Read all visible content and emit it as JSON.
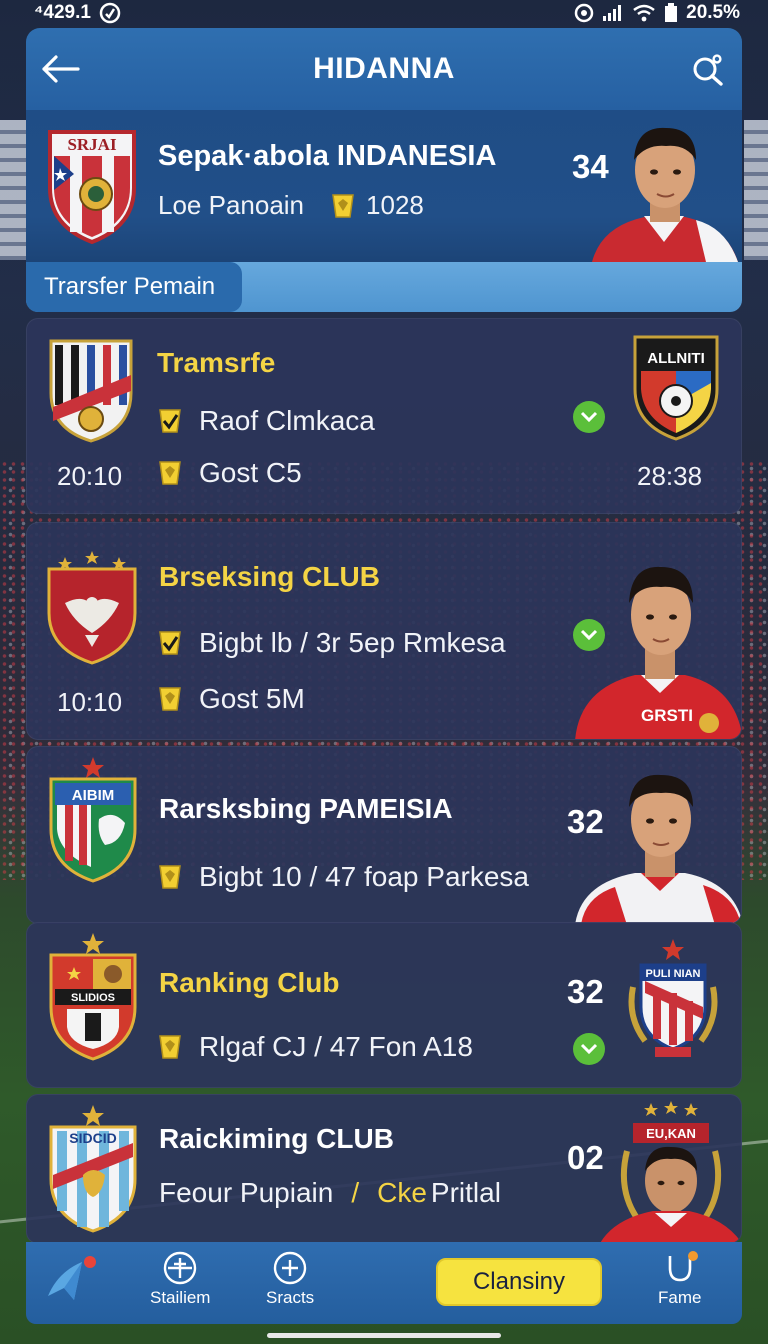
{
  "status_bar": {
    "left_text": "⁴429.1",
    "battery": "20.5%"
  },
  "header": {
    "title": "HIDANNA"
  },
  "featured": {
    "club_name": "Sepak·abola INDANESIA",
    "subtitle": "Loe Panoain",
    "coins": "1028",
    "score": "34",
    "crest_text": "SRJAI"
  },
  "tab": {
    "active_label": "Trarsfer Pemain"
  },
  "cards": [
    {
      "title": "Tramsrfe",
      "line1": "Raof Clmkaca",
      "line2": "Gost C5",
      "time_left": "20:10",
      "time_right": "28:38",
      "right_crest_text": "ALLNITI"
    },
    {
      "title": "Brseksing CLUB",
      "line1": "Bigbt lb  /  3r 5ep Rmkesa",
      "line2": "Gost 5M",
      "time_left": "10:10",
      "player_jersey_text": "GRSTI"
    },
    {
      "title": "Rarsksbing PAMEISIA",
      "line1": "Bigbt 10  / 47 foap Parkesa",
      "score": "32",
      "crest_text": "AIBIM"
    },
    {
      "title": "Ranking Club",
      "line1": "Rlgaf CJ  / 47 Fon A18",
      "score": "32",
      "crest_text": "SLIDIOS",
      "right_crest_text": "PULI NIAN"
    },
    {
      "title": "Raickiming CLUB",
      "line1_white": "Feour Pupiain",
      "line1_sep": "/",
      "line1_yellow": "Cke",
      "line1_end": "Pritlal",
      "score": "02",
      "crest_text": "SIDCID",
      "right_crest_text": "EU,KAN"
    }
  ],
  "bottom_nav": {
    "item1_label": "Stailiem",
    "item2_label": "Sracts",
    "cta_label": "Clansiny",
    "item4_label": "Fame"
  },
  "colors": {
    "accent_yellow": "#f4d445",
    "header_blue": "#2f6fb0",
    "card_bg": "#2c355a",
    "check_green": "#5bbf3a"
  }
}
